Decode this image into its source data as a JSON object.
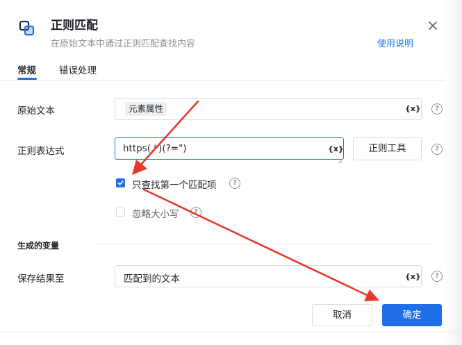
{
  "dialog": {
    "title": "正则匹配",
    "subtitle": "在原始文本中通过正则匹配查找内容",
    "help_link": "使用说明",
    "icons": {
      "app": "regex-match-icon",
      "close": "close-icon"
    }
  },
  "tabs": [
    {
      "label": "常规",
      "active": true
    },
    {
      "label": "错误处理",
      "active": false
    }
  ],
  "form": {
    "source_text": {
      "label": "原始文本",
      "chip": "元素属性",
      "var_button": "{x}"
    },
    "regex": {
      "label": "正则表达式",
      "value": "https(.*)(?=\")",
      "var_button": "{x}",
      "tool_button": "正则工具"
    },
    "first_match_only": {
      "label": "只查找第一个匹配项",
      "checked": true
    },
    "ignore_case": {
      "label": "忽略大小写",
      "checked": false
    }
  },
  "output": {
    "section_title": "生成的变量",
    "save_to": {
      "label": "保存结果至",
      "value": "匹配到的文本",
      "var_button": "{x}"
    }
  },
  "footer": {
    "cancel": "取消",
    "ok": "确定"
  },
  "colors": {
    "accent": "#1e6fe8",
    "annotation_arrow": "#e8372c"
  }
}
